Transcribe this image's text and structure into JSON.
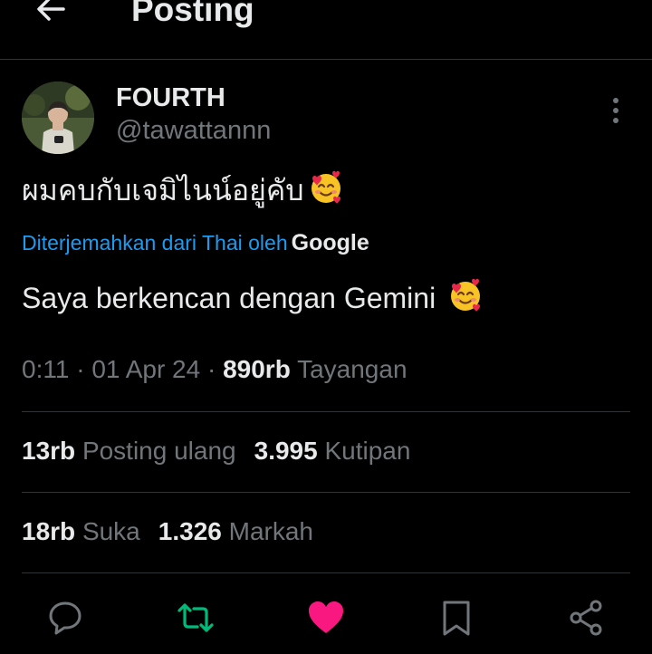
{
  "header": {
    "title": "Posting"
  },
  "author": {
    "name": "FOURTH",
    "handle": "@tawattannn"
  },
  "tweet": {
    "text": "ผมคบกับเจมิไนน์อยู่คับ"
  },
  "translation": {
    "label": "Diterjemahkan dari Thai oleh",
    "brand": "Google",
    "text": "Saya berkencan dengan Gemini"
  },
  "meta": {
    "time": "0:11",
    "sep1": " · ",
    "date": "01 Apr 24",
    "sep2": " · ",
    "views_count": "890rb",
    "views_label": "Tayangan"
  },
  "stats": {
    "reposts_count": "13rb",
    "reposts_label": "Posting ulang",
    "quotes_count": "3.995",
    "quotes_label": "Kutipan",
    "likes_count": "18rb",
    "likes_label": "Suka",
    "bookmarks_count": "1.326",
    "bookmarks_label": "Markah"
  },
  "actions": {
    "reply_icon": "reply-icon",
    "retweet_icon": "retweet-icon",
    "like_icon": "heart-icon",
    "bookmark_icon": "bookmark-icon",
    "share_icon": "share-icon"
  },
  "colors": {
    "background": "#000000",
    "text": "#e7e9ea",
    "muted": "#71767b",
    "link": "#1d9bf0",
    "retweet_green": "#00ba7c",
    "like_pink": "#f91880"
  }
}
